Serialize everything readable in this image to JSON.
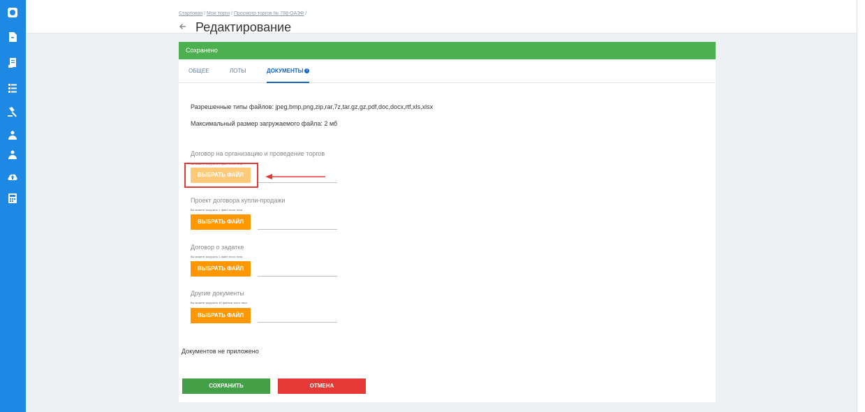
{
  "breadcrumb": {
    "items": [
      "Стартовая",
      "Мои торги",
      "Просмотр торгов № 788-ОАЭФ"
    ],
    "separator": "/"
  },
  "header": {
    "back_icon": "arrow-left-icon",
    "title": "Редактирование"
  },
  "alert": {
    "text": "Сохранено",
    "color": "#4caf50"
  },
  "tabs": [
    {
      "label": "ОБЩЕЕ",
      "active": false
    },
    {
      "label": "ЛОТЫ",
      "active": false
    },
    {
      "label": "ДОКУМЕНТЫ",
      "active": true,
      "icon": "info-icon"
    }
  ],
  "info": {
    "allowed_types": "Разрешенные типы файлов: jpeg,bmp,png,zip,rar,7z,tar.gz,gz,pdf,doc,docx,rtf,xls,xlsx",
    "max_size": "Максимальный размер загружаемого файла: 2 мб"
  },
  "documents": [
    {
      "label": "Договор на организацию и проведение торгов",
      "hint": "Вы можете загрузить 1 файл этого типа",
      "button": "ВЫБРАТЬ ФАЙЛ",
      "highlighted": true
    },
    {
      "label": "Проект договора купли-продажи",
      "hint": "Вы можете загрузить 1 файл этого типа",
      "button": "ВЫБРАТЬ ФАЙЛ",
      "highlighted": false
    },
    {
      "label": "Договор о задатке",
      "hint": "Вы можете загрузить 1 файл этого типа",
      "button": "ВЫБРАТЬ ФАЙЛ",
      "highlighted": false
    },
    {
      "label": "Другие документы",
      "hint": "Вы можете загрузить 40 файлов этого типа",
      "button": "ВЫБРАТЬ ФАЙЛ",
      "highlighted": false
    }
  ],
  "status": {
    "no_docs": "Документов не приложено"
  },
  "actions": {
    "save": "СОХРАНИТЬ",
    "cancel": "ОТМЕНА"
  },
  "sidebar": {
    "icons": [
      "logo-icon",
      "document-icon",
      "scroll-icon",
      "list-icon",
      "gavel-icon",
      "user-icon",
      "user-group-icon",
      "cloud-upload-icon",
      "calculator-icon"
    ]
  },
  "colors": {
    "sidebar": "#1e88e5",
    "accent": "#ff9800",
    "save": "#43a047",
    "cancel": "#e53935"
  }
}
